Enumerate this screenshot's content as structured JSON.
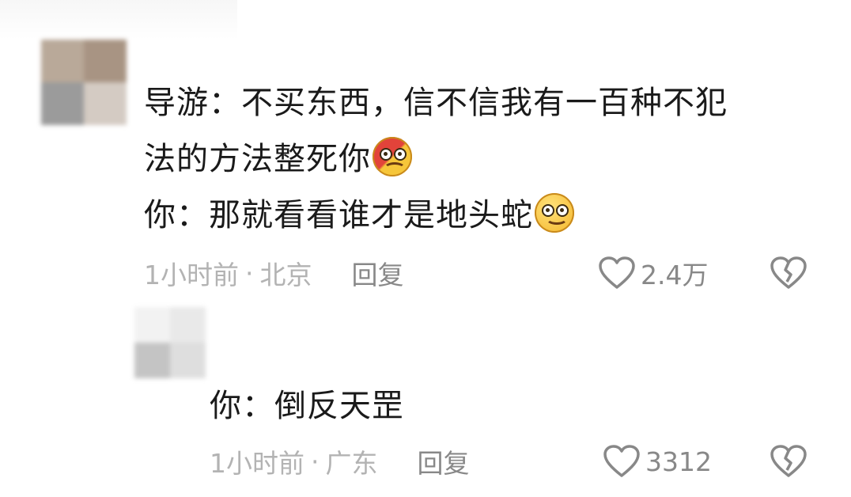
{
  "comments": [
    {
      "lines": [
        "导游：不买东西，信不信我有一百种不犯",
        "法的方法整死你",
        "你：那就看看谁才是地头蛇"
      ],
      "emojis": [
        "angry-emoji",
        "smile-emoji"
      ],
      "time": "1小时前",
      "separator": "·",
      "location": "北京",
      "reply_label": "回复",
      "likes": "2.4万",
      "avatar_colors": [
        "#b9a999",
        "#a89483",
        "#9b9b9b",
        "#d4cbc3"
      ]
    },
    {
      "lines": [
        "你：倒反天罡"
      ],
      "time": "1小时前",
      "separator": "·",
      "location": "广东",
      "reply_label": "回复",
      "likes": "3312",
      "avatar_colors": [
        "#f2f2f2",
        "#e9e9e9",
        "#c4c4c4",
        "#dedede"
      ]
    }
  ],
  "colors": {
    "text": "#1a1a1a",
    "meta": "#b3b3b3",
    "action": "#888888"
  }
}
